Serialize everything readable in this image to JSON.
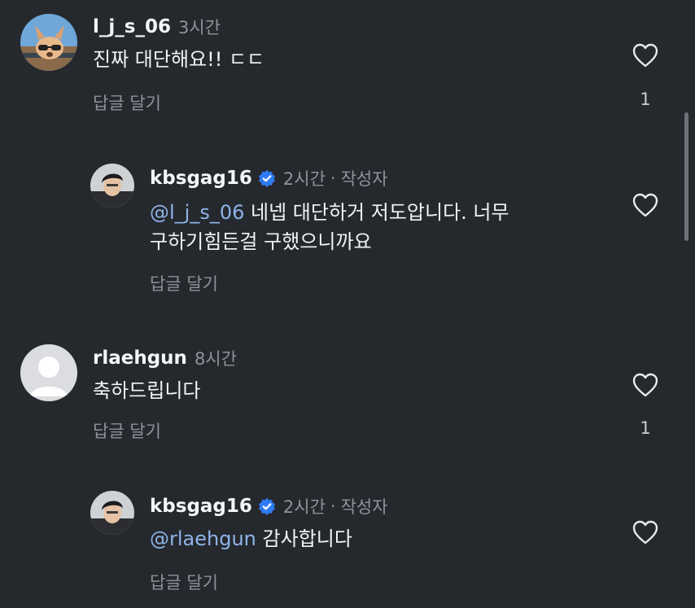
{
  "comments": [
    {
      "username": "l_j_s_06",
      "time": "3시간",
      "text": "진짜 대단해요!! ㄷㄷ",
      "reply_label": "답글 달기",
      "like_count": "1",
      "avatar": "dog-with-sunglasses-avatar"
    },
    {
      "username": "kbsgag16",
      "time": "2시간",
      "separator": "·",
      "author_tag": "작성자",
      "verified": true,
      "mention": "@l_j_s_06",
      "text_line1": " 네넵 대단하거 저도압니다. 너무",
      "text_line2": "구하기힘든걸 구했으니까요",
      "reply_label": "답글 달기",
      "avatar": "man-portrait-avatar"
    },
    {
      "username": "rlaehgun",
      "time": "8시간",
      "text": "축하드립니다",
      "reply_label": "답글 달기",
      "like_count": "1",
      "avatar": "default-person-avatar"
    },
    {
      "username": "kbsgag16",
      "time": "2시간",
      "separator": "·",
      "author_tag": "작성자",
      "verified": true,
      "mention": "@rlaehgun",
      "text": " 감사합니다",
      "reply_label": "답글 달기",
      "avatar": "man-portrait-avatar"
    }
  ],
  "colors": {
    "background": "#25292e",
    "mention": "#8fb3e8",
    "muted": "#8e9399",
    "verified": "#2f7cf6"
  }
}
